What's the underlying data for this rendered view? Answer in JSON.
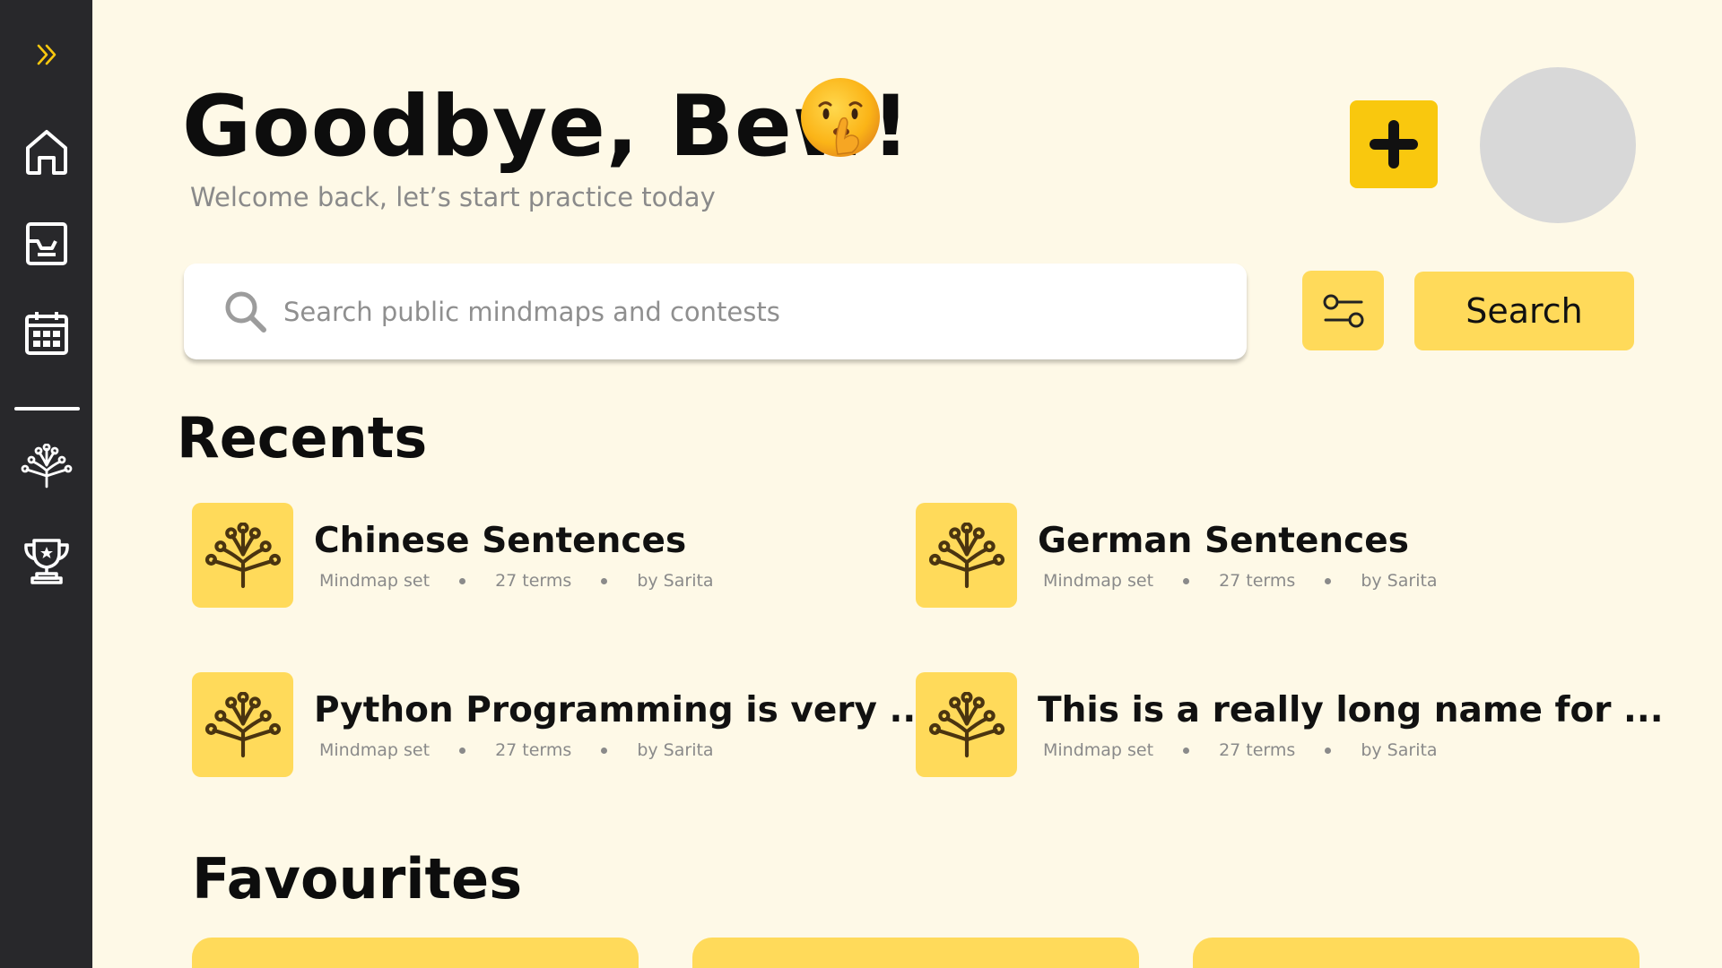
{
  "sidebar": {
    "items": [
      {
        "name": "expand",
        "icon": "double-chevron-right-icon"
      },
      {
        "name": "home",
        "icon": "home-icon"
      },
      {
        "name": "inbox",
        "icon": "inbox-icon"
      },
      {
        "name": "calendar",
        "icon": "calendar-icon"
      },
      {
        "name": "mindmaps",
        "icon": "mindmap-tree-icon"
      },
      {
        "name": "contests",
        "icon": "trophy-icon"
      }
    ]
  },
  "header": {
    "greeting": "Goodbye, Bew!",
    "emoji": "shushing-face-emoji",
    "subtitle": "Welcome back, let’s start practice today"
  },
  "search": {
    "placeholder": "Search public mindmaps and contests",
    "button_label": "Search"
  },
  "recents": {
    "title": "Recents",
    "items": [
      {
        "title": "Chinese Sentences",
        "type": "Mindmap set",
        "terms": "27 terms",
        "author": "by Sarita"
      },
      {
        "title": "German Sentences",
        "type": "Mindmap set",
        "terms": "27 terms",
        "author": "by Sarita"
      },
      {
        "title": "Python Programming is very ...",
        "type": "Mindmap set",
        "terms": "27 terms",
        "author": "by Sarita"
      },
      {
        "title": "This is a really long name for ...",
        "type": "Mindmap set",
        "terms": "27 terms",
        "author": "by Sarita"
      }
    ]
  },
  "favourites": {
    "title": "Favourites"
  },
  "colors": {
    "background": "#FEF9E7",
    "sidebar": "#28282B",
    "accent": "#F9C80E",
    "card_accent": "#FFDA5A",
    "avatar_placeholder": "#D8D8D8"
  }
}
